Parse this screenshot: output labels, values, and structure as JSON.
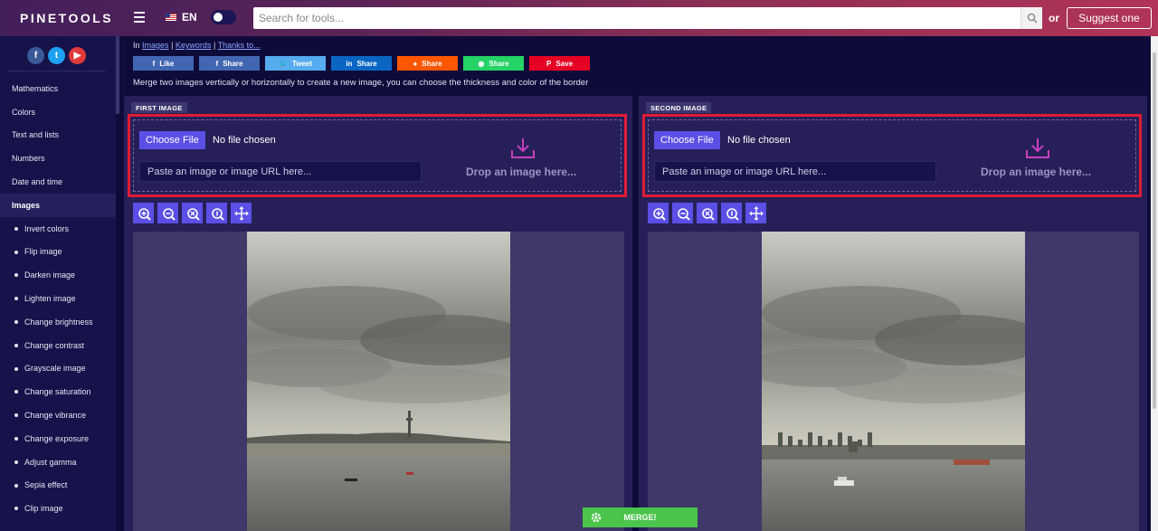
{
  "header": {
    "logo": "PINETOOLS",
    "language": "EN",
    "search_placeholder": "Search for tools...",
    "or_label": "or",
    "suggest_label": "Suggest one"
  },
  "sidebar": {
    "social": [
      {
        "icon": "facebook-icon",
        "glyph": "f",
        "color": "#3b5998"
      },
      {
        "icon": "twitter-icon",
        "glyph": "t",
        "color": "#1da1f2"
      },
      {
        "icon": "youtube-icon",
        "glyph": "▶",
        "color": "#e03a3a"
      }
    ],
    "items": [
      {
        "label": "Mathematics",
        "type": "category"
      },
      {
        "label": "Colors",
        "type": "category"
      },
      {
        "label": "Text and lists",
        "type": "category"
      },
      {
        "label": "Numbers",
        "type": "category"
      },
      {
        "label": "Date and time",
        "type": "category"
      },
      {
        "label": "Images",
        "type": "active"
      },
      {
        "label": "Invert colors",
        "type": "sub"
      },
      {
        "label": "Flip image",
        "type": "sub"
      },
      {
        "label": "Darken image",
        "type": "sub"
      },
      {
        "label": "Lighten image",
        "type": "sub"
      },
      {
        "label": "Change brightness",
        "type": "sub"
      },
      {
        "label": "Change contrast",
        "type": "sub"
      },
      {
        "label": "Grayscale image",
        "type": "sub"
      },
      {
        "label": "Change saturation",
        "type": "sub"
      },
      {
        "label": "Change vibrance",
        "type": "sub"
      },
      {
        "label": "Change exposure",
        "type": "sub"
      },
      {
        "label": "Adjust gamma",
        "type": "sub"
      },
      {
        "label": "Sepia effect",
        "type": "sub"
      },
      {
        "label": "Clip image",
        "type": "sub"
      }
    ]
  },
  "breadcrumb": {
    "prefix": "In",
    "links": [
      "Images",
      "Keywords",
      "Thanks to..."
    ]
  },
  "share_buttons": [
    {
      "label": "Like",
      "icon": "facebook-icon",
      "glyph": "f",
      "color": "#4267b2"
    },
    {
      "label": "Share",
      "icon": "facebook-icon",
      "glyph": "f",
      "color": "#4267b2"
    },
    {
      "label": "Tweet",
      "icon": "twitter-icon",
      "glyph": "🐦",
      "color": "#55acee"
    },
    {
      "label": "Share",
      "icon": "linkedin-icon",
      "glyph": "in",
      "color": "#0a66c2"
    },
    {
      "label": "Share",
      "icon": "reddit-icon",
      "glyph": "●",
      "color": "#ff5700"
    },
    {
      "label": "Share",
      "icon": "whatsapp-icon",
      "glyph": "◉",
      "color": "#25d366"
    },
    {
      "label": "Save",
      "icon": "pinterest-icon",
      "glyph": "P",
      "color": "#e60023"
    }
  ],
  "description": "Merge two images vertically or horizontally to create a new image, you can choose the thickness and color of the border",
  "panels": [
    {
      "title": "FIRST IMAGE",
      "choose_label": "Choose File",
      "no_file": "No file chosen",
      "url_placeholder": "Paste an image or image URL here...",
      "drop_label": "Drop an image here..."
    },
    {
      "title": "SECOND IMAGE",
      "choose_label": "Choose File",
      "no_file": "No file chosen",
      "url_placeholder": "Paste an image or image URL here...",
      "drop_label": "Drop an image here..."
    }
  ],
  "tools": [
    "zoom-in-icon",
    "zoom-out-icon",
    "zoom-reset-icon",
    "zoom-actual-icon",
    "move-icon"
  ],
  "merge_label": "MERGE!",
  "colors": {
    "accent": "#5b4fe6",
    "highlight": "#e01b35",
    "merge": "#4ac44a",
    "panel": "#272058",
    "background": "#0e0b3a"
  }
}
